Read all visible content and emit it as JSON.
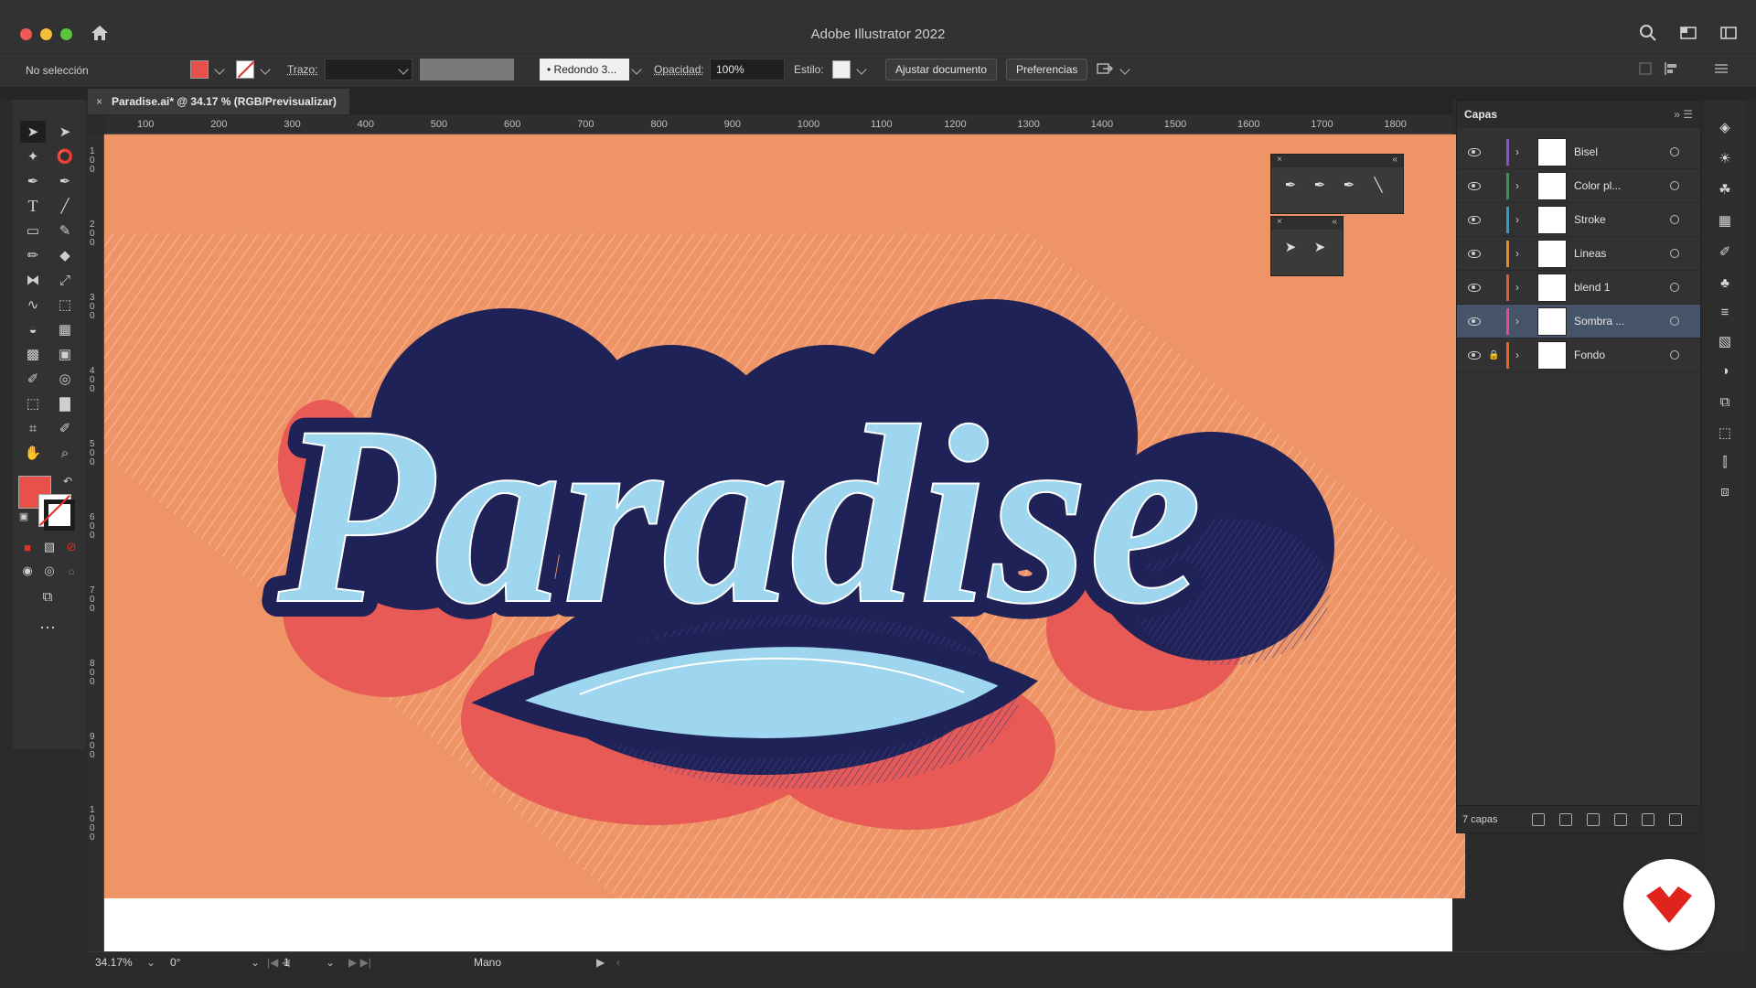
{
  "window": {
    "title": "Adobe Illustrator 2022"
  },
  "controlbar": {
    "selection": "No selección",
    "stroke_label": "Trazo:",
    "brush": "Redondo 3...",
    "opacity_label": "Opacidad:",
    "opacity_value": "100%",
    "style_label": "Estilo:",
    "adjust_button": "Ajustar documento",
    "prefs_button": "Preferencias",
    "fill_color": "#e8504b"
  },
  "document": {
    "tab_title": "Paradise.ai* @ 34.17 % (RGB/Previsualizar)",
    "artwork_text": "Paradise",
    "background_color": "#ef9466"
  },
  "ruler_top": [
    "100",
    "200",
    "300",
    "400",
    "500",
    "600",
    "700",
    "800",
    "900",
    "1000",
    "1100",
    "1200",
    "1300",
    "1400",
    "1500",
    "1600",
    "1700",
    "1800"
  ],
  "ruler_left": [
    "100",
    "200",
    "300",
    "400",
    "500",
    "600",
    "700",
    "800",
    "900",
    "1000"
  ],
  "layers_panel": {
    "tab": "Capas",
    "count": "7 capas",
    "layers": [
      {
        "name": "Bisel",
        "color": "#8a4fd6",
        "locked": false,
        "selected": false
      },
      {
        "name": "Color pl...",
        "color": "#2f9b4a",
        "locked": false,
        "selected": false
      },
      {
        "name": "Stroke",
        "color": "#2aa0c8",
        "locked": false,
        "selected": false
      },
      {
        "name": "Lineas",
        "color": "#f08a1a",
        "locked": false,
        "selected": false
      },
      {
        "name": "blend 1",
        "color": "#e25a2a",
        "locked": false,
        "selected": false
      },
      {
        "name": "Sombra ...",
        "color": "#e84a8a",
        "locked": false,
        "selected": true
      },
      {
        "name": "Fondo",
        "color": "#f06020",
        "locked": true,
        "selected": false
      }
    ]
  },
  "status": {
    "zoom": "34.17%",
    "rotation": "0°",
    "artboard": "1",
    "tool": "Mano"
  }
}
